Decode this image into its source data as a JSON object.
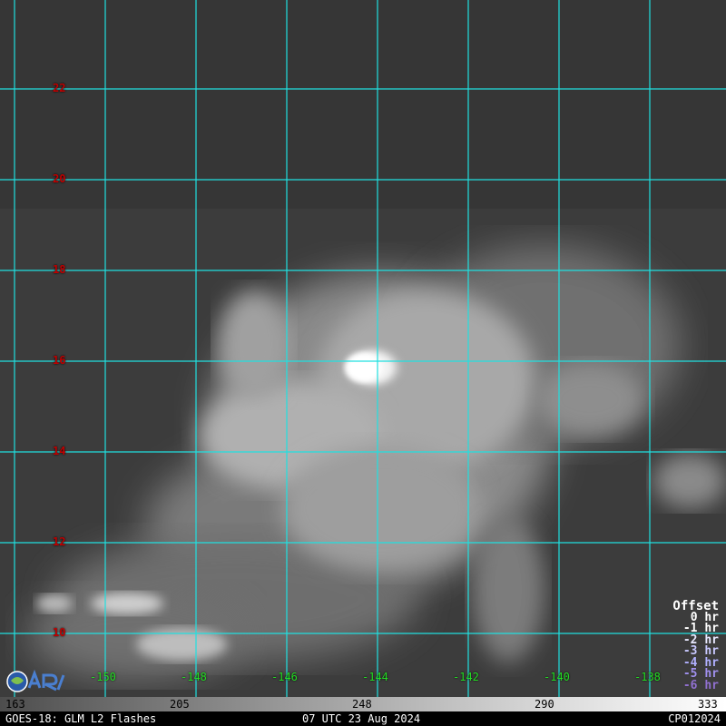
{
  "latitude_labels": [
    "22",
    "20",
    "18",
    "16",
    "14",
    "12",
    "10"
  ],
  "longitude_labels": [
    "-150",
    "-148",
    "-146",
    "-144",
    "-142",
    "-140",
    "-138"
  ],
  "legend": {
    "title": "Offset",
    "items": [
      {
        "label": "0 hr",
        "color": "#ffffff"
      },
      {
        "label": "-1 hr",
        "color": "#ffffff"
      },
      {
        "label": "-2 hr",
        "color": "#e8e8ff"
      },
      {
        "label": "-3 hr",
        "color": "#c8c8ff"
      },
      {
        "label": "-4 hr",
        "color": "#b0b0ff"
      },
      {
        "label": "-5 hr",
        "color": "#a090ee"
      },
      {
        "label": "-6 hr",
        "color": "#9070d0"
      }
    ]
  },
  "colorbar_labels": [
    "163",
    "205",
    "248",
    "290",
    "333"
  ],
  "footer": {
    "left": "GOES-18: GLM L2 Flashes",
    "center": "07 UTC 23 Aug 2024",
    "right": "CP012024"
  },
  "colors": {
    "grid": "#20e0e0",
    "lat_label": "#c00000",
    "lon_label": "#22dd22",
    "background": "#3a3a3a"
  },
  "logo_icon": "cira-logo-icon"
}
